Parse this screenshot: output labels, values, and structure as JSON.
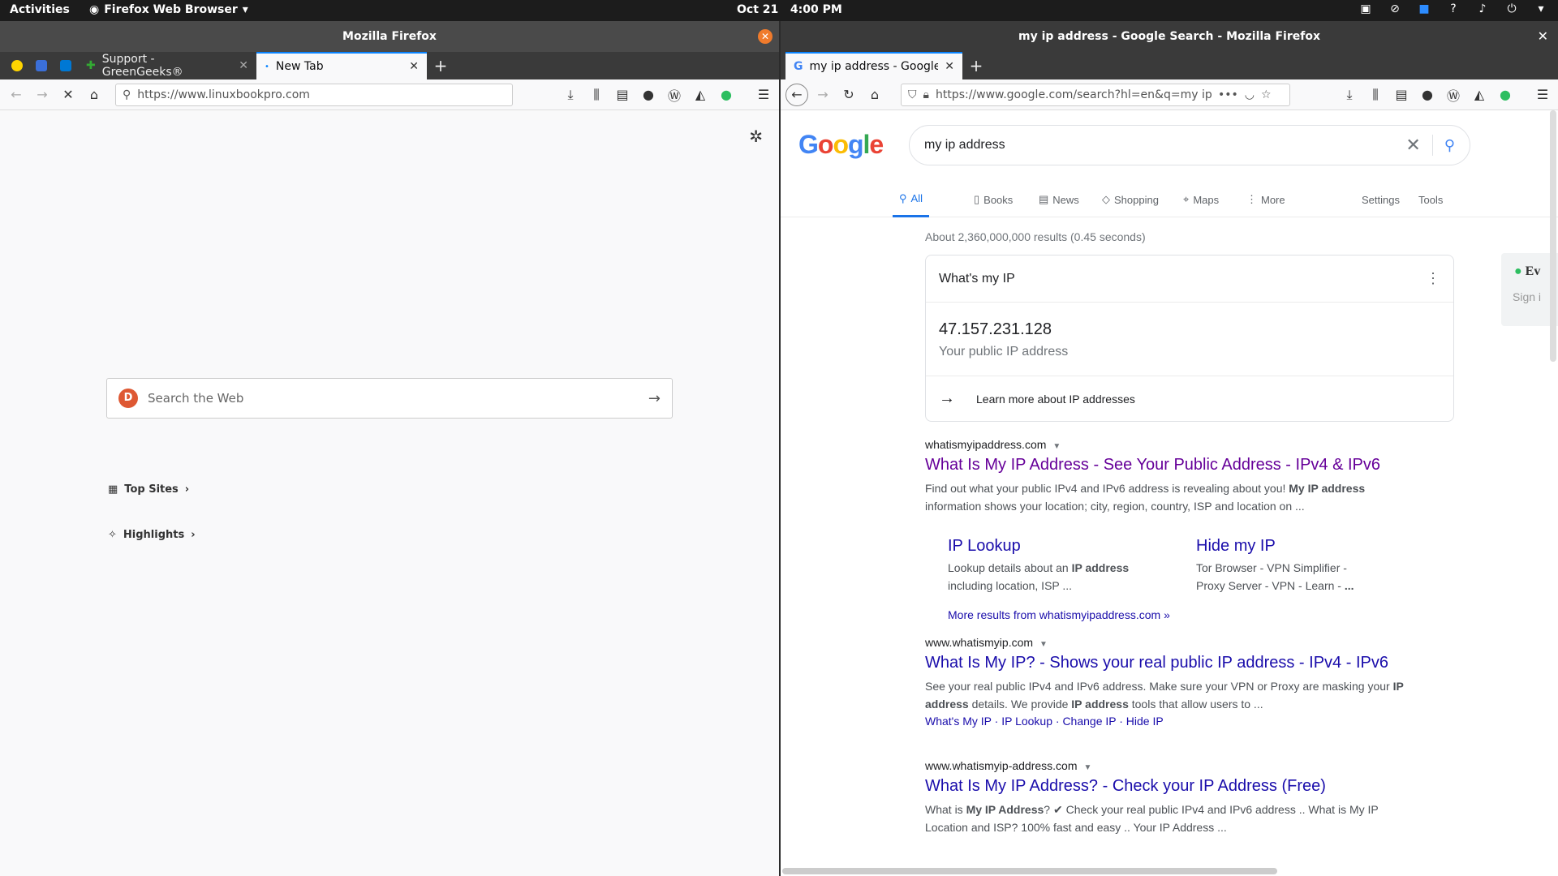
{
  "topbar": {
    "activities": "Activities",
    "app_name": "Firefox Web Browser",
    "clock_date": "Oct 21",
    "clock_time": "4:00 PM"
  },
  "left": {
    "title": "Mozilla Firefox",
    "tabs": [
      {
        "label": "Support - GreenGeeks®"
      },
      {
        "label": "New Tab"
      }
    ],
    "url": "https://www.linuxbookpro.com",
    "search_placeholder": "Search the Web",
    "sections": {
      "top_sites": "Top Sites",
      "highlights": "Highlights"
    }
  },
  "right": {
    "title": "my ip address - Google Search - Mozilla Firefox",
    "tab_label": "my ip address - Google Sea",
    "url": "https://www.google.com/search?hl=en&q=my ip addr",
    "google": {
      "logo": "Google",
      "query": "my ip address",
      "tabs": [
        "All",
        "Books",
        "News",
        "Shopping",
        "Maps",
        "More"
      ],
      "settings": "Settings",
      "tools": "Tools",
      "stats": "About 2,360,000,000 results (0.45 seconds)",
      "card": {
        "header": "What's my IP",
        "ip": "47.157.231.128",
        "label": "Your public IP address",
        "learn": "Learn more about IP addresses"
      },
      "results": [
        {
          "cite": "whatismyipaddress.com",
          "title": "What Is My IP Address - See Your Public Address - IPv4 & IPv6",
          "snippet_1": "Find out what your public IPv4 and IPv6 address is revealing about you! ",
          "snippet_b1": "My IP address",
          "snippet_2": " information shows your location; city, region, country, ISP and location on ..."
        },
        {
          "cite": "www.whatismyip.com",
          "title": "What Is My IP? - Shows your real public IP address - IPv4 - IPv6",
          "snippet_1": "See your real public IPv4 and IPv6 address. Make sure your VPN or Proxy are masking your ",
          "snippet_b1": "IP address",
          "snippet_2": " details. We provide ",
          "snippet_b2": "IP address",
          "snippet_3": " tools that allow users to ...",
          "links": "What's My IP · IP Lookup · Change IP · Hide IP"
        },
        {
          "cite": "www.whatismyip-address.com",
          "title": "What Is My IP Address? - Check your IP Address (Free)",
          "snippet_1": "What is ",
          "snippet_b1": "My IP Address",
          "snippet_2": "? ✔ Check your real public IPv4 and IPv6 address .. What is My IP Location and ISP? 100% fast and easy .. Your IP Address ..."
        }
      ],
      "sitelinks": [
        {
          "title": "IP Lookup",
          "desc_1": "Lookup details about an ",
          "desc_b": "IP address",
          "desc_2": " including location, ISP ..."
        },
        {
          "title": "Hide my IP",
          "desc_1": "Tor Browser - VPN Simplifier - Proxy Server - VPN - Learn - ",
          "desc_b": "...",
          "desc_2": ""
        }
      ],
      "more_results": "More results from whatismyipaddress.com »",
      "evernote": {
        "title": "Ev",
        "signin": "Sign i"
      }
    }
  }
}
